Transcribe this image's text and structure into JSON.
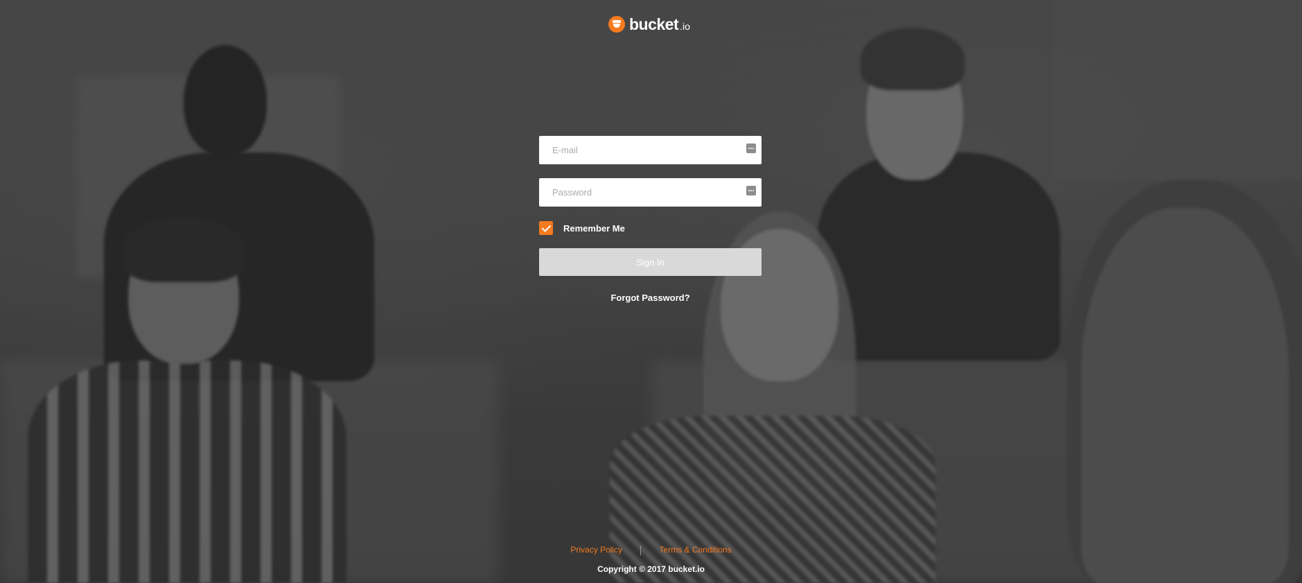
{
  "brand": {
    "name": "bucket",
    "tld": ".io",
    "accent_color": "#f47b20"
  },
  "form": {
    "email": {
      "placeholder": "E-mail",
      "value": "",
      "icon": "autofill-key-icon"
    },
    "password": {
      "placeholder": "Password",
      "value": "",
      "icon": "autofill-key-icon"
    },
    "remember_me": {
      "label": "Remember Me",
      "checked": true
    },
    "signin_label": "Sign In",
    "forgot_label": "Forgot Password?"
  },
  "footer": {
    "privacy_label": "Privacy Policy",
    "terms_label": "Terms & Conditions",
    "copyright": "Copyright © 2017 bucket.io"
  }
}
